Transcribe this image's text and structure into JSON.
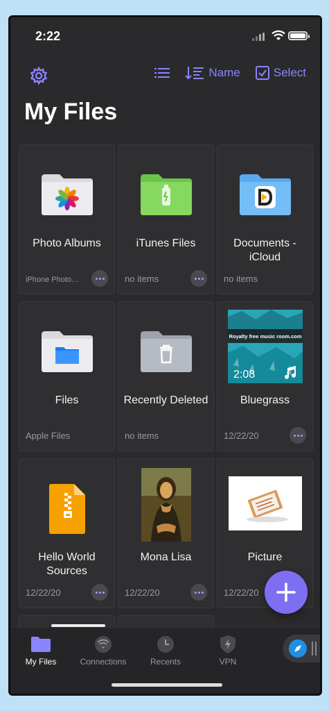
{
  "status": {
    "time": "2:22"
  },
  "toolbar": {
    "sort_label": "Name",
    "select_label": "Select"
  },
  "page": {
    "title": "My Files"
  },
  "items": [
    {
      "name": "Photo Albums",
      "meta": "iPhone Photo…",
      "icon": "photos-folder-icon"
    },
    {
      "name": "iTunes Files",
      "meta": "no items",
      "icon": "itunes-folder-icon"
    },
    {
      "name": "Documents - iCloud",
      "meta": "no items",
      "icon": "documents-folder-icon"
    },
    {
      "name": "Files",
      "meta": "Apple Files",
      "icon": "files-folder-icon"
    },
    {
      "name": "Recently Deleted",
      "meta": "no items",
      "icon": "trash-folder-icon"
    },
    {
      "name": "Bluegrass",
      "meta": "12/22/20",
      "icon": "video-thumbnail",
      "duration": "2:08",
      "overlay_text": "Royalty free music room.com"
    },
    {
      "name": "Hello World Sources",
      "meta": "12/22/20",
      "icon": "zip-file-icon"
    },
    {
      "name": "Mona Lisa",
      "meta": "12/22/20",
      "icon": "image-thumbnail"
    },
    {
      "name": "Picture",
      "meta": "12/22/20",
      "icon": "image-thumbnail"
    }
  ],
  "tabs": [
    {
      "label": "My Files",
      "icon": "folder-icon",
      "active": true
    },
    {
      "label": "Connections",
      "icon": "wifi-icon"
    },
    {
      "label": "Recents",
      "icon": "clock-icon"
    },
    {
      "label": "VPN",
      "icon": "shield-bolt-icon"
    }
  ],
  "colors": {
    "accent": "#8b84ff",
    "background": "#2a2a2c",
    "fab": "#7e6ff2"
  }
}
